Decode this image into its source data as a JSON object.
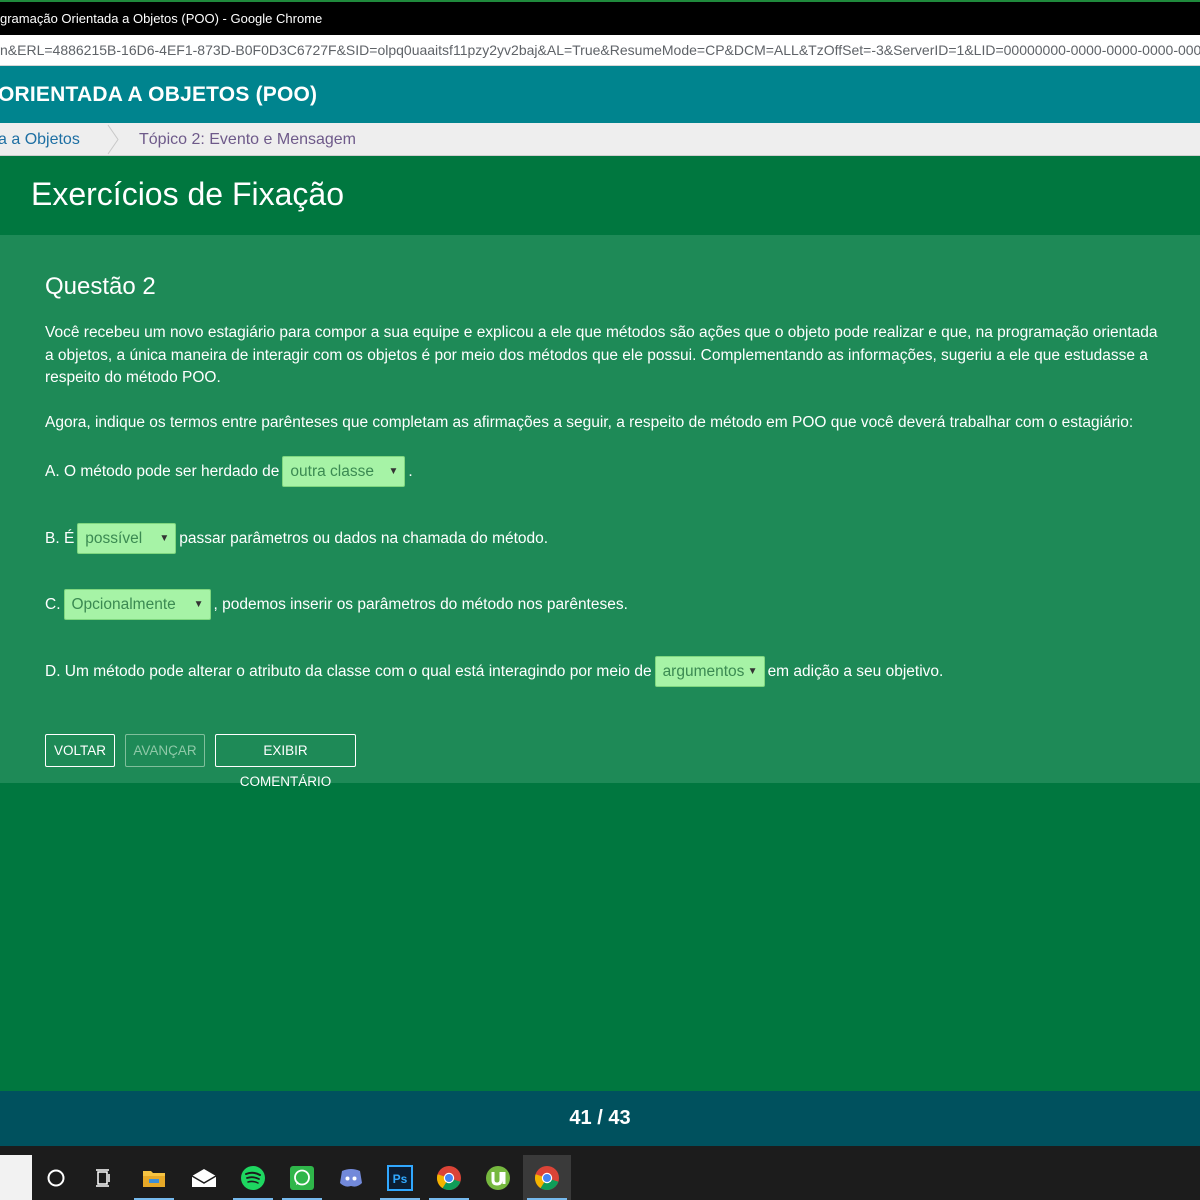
{
  "window": {
    "title": "gramação Orientada a Objetos (POO) - Google Chrome",
    "url": "n&ERL=4886215B-16D6-4EF1-873D-B0F0D3C6727F&SID=olpq0uaaitsf11pzy2yv2baj&AL=True&ResumeMode=CP&DCM=ALL&TzOffSet=-3&ServerID=1&LID=00000000-0000-0000-0000-0000000"
  },
  "course": {
    "title": "ORIENTADA A OBJETOS (POO)"
  },
  "breadcrumb": {
    "items": [
      "a a Objetos",
      "Tópico 2: Evento e Mensagem"
    ]
  },
  "section": {
    "title": "Exercícios de Fixação"
  },
  "question": {
    "title": "Questão 2",
    "text": "Você recebeu um novo estagiário para compor a sua equipe e explicou a ele que métodos são ações que o objeto pode realizar e que, na programação orientada a objetos, a única maneira de interagir com os objetos é por meio dos métodos que ele possui. Complementando as informações, sugeriu a ele que estudasse a respeito do método POO.",
    "instruction": "Agora, indique os termos entre parênteses que completam as afirmações a seguir, a respeito de método em POO que você deverá trabalhar com o estagiário:",
    "statements": [
      {
        "before": "A. O método pode ser herdado de",
        "selected": "outra classe",
        "after": "."
      },
      {
        "before": "B. É",
        "selected": "possível",
        "after": "passar parâmetros ou dados na chamada do método."
      },
      {
        "before": "C.",
        "selected": "Opcionalmente",
        "after": ", podemos inserir os parâmetros do método nos parênteses."
      },
      {
        "before": "D. Um método pode alterar o atributo da classe com o qual está interagindo por meio de",
        "selected": "argumentos",
        "after": "em adição a seu objetivo."
      }
    ]
  },
  "buttons": {
    "back": "VOLTAR",
    "next": "AVANÇAR",
    "comment": "EXIBIR COMENTÁRIO"
  },
  "pager": {
    "label": "41 / 43"
  },
  "taskbar": {
    "icons": [
      "search-box",
      "cortana-icon",
      "task-view-icon",
      "file-explorer-icon",
      "mail-icon",
      "spotify-icon",
      "whatsapp-icon",
      "discord-icon",
      "photoshop-icon",
      "chrome-icon",
      "utorrent-icon",
      "chrome-icon"
    ],
    "photoshop_label": "Ps"
  },
  "colors": {
    "course_header": "#00848e",
    "section_bg": "#00773f",
    "panel_bg": "#1e8a57",
    "select_bg": "#a6f3a6",
    "pager_bg": "#00515e"
  }
}
